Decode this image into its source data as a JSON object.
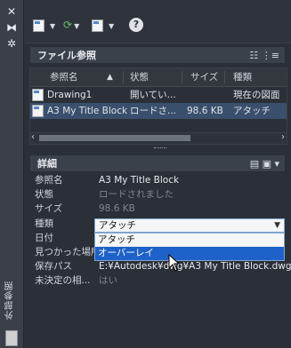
{
  "sidebar": {
    "vertical_label": "外部参照"
  },
  "toolbar": {
    "help_label": "?"
  },
  "file_references": {
    "title": "ファイル参照",
    "columns": [
      "参照名",
      "状態",
      "サイズ",
      "種類"
    ],
    "rows": [
      {
        "name": "Drawing1",
        "status": "開いてい...",
        "size": "",
        "type": "現在の図面"
      },
      {
        "name": "A3 My Title Block",
        "status": "ロードさ...",
        "size": "98.6 KB",
        "type": "アタッチ"
      }
    ]
  },
  "details": {
    "title": "詳細",
    "rows": [
      {
        "key": "参照名",
        "value": "A3 My Title Block"
      },
      {
        "key": "状態",
        "value": "ロードされました"
      },
      {
        "key": "サイズ",
        "value": "98.6 KB"
      },
      {
        "key": "種類",
        "value": "アタッチ"
      },
      {
        "key": "日付",
        "value": ""
      },
      {
        "key": "見つかった場所",
        "value": ""
      },
      {
        "key": "保存パス",
        "value": "E:¥Autodesk¥dwg¥A3 My Title Block.dwg"
      },
      {
        "key": "未決定の相...",
        "value": "はい"
      }
    ],
    "type_dropdown": {
      "selected": "アタッチ",
      "options": [
        "アタッチ",
        "オーバーレイ"
      ],
      "highlighted": "オーバーレイ"
    }
  },
  "colors": {
    "accent": "#1e62c9",
    "panel": "#2b2f37",
    "selected_row": "#3a4f6c"
  }
}
